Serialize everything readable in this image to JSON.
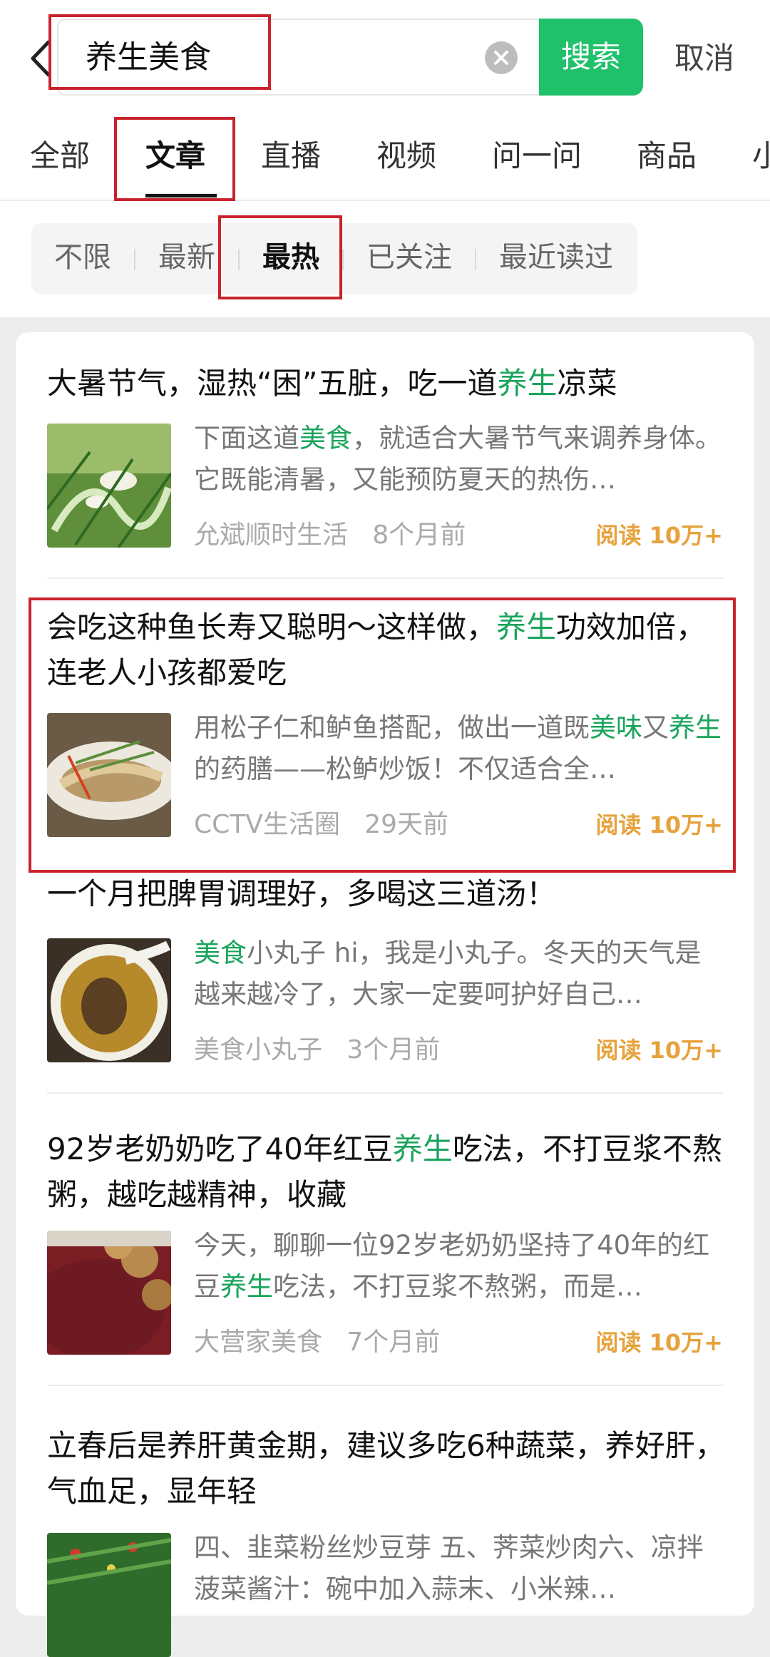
{
  "search": {
    "query": "养生美食",
    "button_label": "搜索",
    "cancel_label": "取消"
  },
  "tabs": [
    {
      "label": "全部"
    },
    {
      "label": "文章"
    },
    {
      "label": "直播"
    },
    {
      "label": "视频"
    },
    {
      "label": "问一问"
    },
    {
      "label": "商品"
    },
    {
      "label": "小"
    }
  ],
  "active_tab": "文章",
  "filters": [
    {
      "label": "不限"
    },
    {
      "label": "最新"
    },
    {
      "label": "最热"
    },
    {
      "label": "已关注"
    },
    {
      "label": "最近读过"
    }
  ],
  "active_filter": "最热",
  "results": [
    {
      "title": [
        "大暑节气，湿热“困”五脏，吃一道",
        "养生",
        "凉菜"
      ],
      "snippet": [
        "下面这道",
        "美食",
        "，就适合大暑节气来调养身体。它既能清暑，又能预防夏天的热伤…"
      ],
      "source": "允斌顺时生活",
      "time": "8个月前",
      "reads": "阅读 10万+"
    },
    {
      "title": [
        "会吃这种鱼长寿又聪明～这样做，",
        "养生",
        "功效加倍，连老人小孩都爱吃"
      ],
      "snippet": [
        "用松子仁和鲈鱼搭配，做出一道既",
        "美味",
        "又",
        "养生",
        "的药膳——松鲈炒饭！不仅适合全…"
      ],
      "source": "CCTV生活圈",
      "time": "29天前",
      "reads": "阅读 10万+"
    },
    {
      "title": [
        "一个月把脾胃调理好，多喝这三道汤！"
      ],
      "snippet": [
        "美食",
        "小丸子 hi，我是小丸子。冬天的天气是越来越冷了，大家一定要呵护好自己…"
      ],
      "source": "美食小丸子",
      "time": "3个月前",
      "reads": "阅读 10万+"
    },
    {
      "title": [
        "92岁老奶奶吃了40年红豆",
        "养生",
        "吃法，不打豆浆不熬粥，越吃越精神，收藏"
      ],
      "snippet": [
        "今天，聊聊一位92岁老奶奶坚持了40年的红豆",
        "养生",
        "吃法，不打豆浆不熬粥，而是…"
      ],
      "source": "大营家美食",
      "time": "7个月前",
      "reads": "阅读 10万+"
    },
    {
      "title": [
        "立春后是养肝黄金期，建议多吃6种蔬菜，养好肝，气血足，显年轻"
      ],
      "snippet": [
        "四、韭菜粉丝炒豆芽 五、荠菜炒肉六、凉拌菠菜酱汁：碗中加入蒜末、小米辣…"
      ]
    }
  ],
  "colors": {
    "accent_green": "#1fc16b",
    "highlight_green": "#1aa45c",
    "reads_orange": "#e6a23c",
    "annotation_red": "#c8232c"
  }
}
